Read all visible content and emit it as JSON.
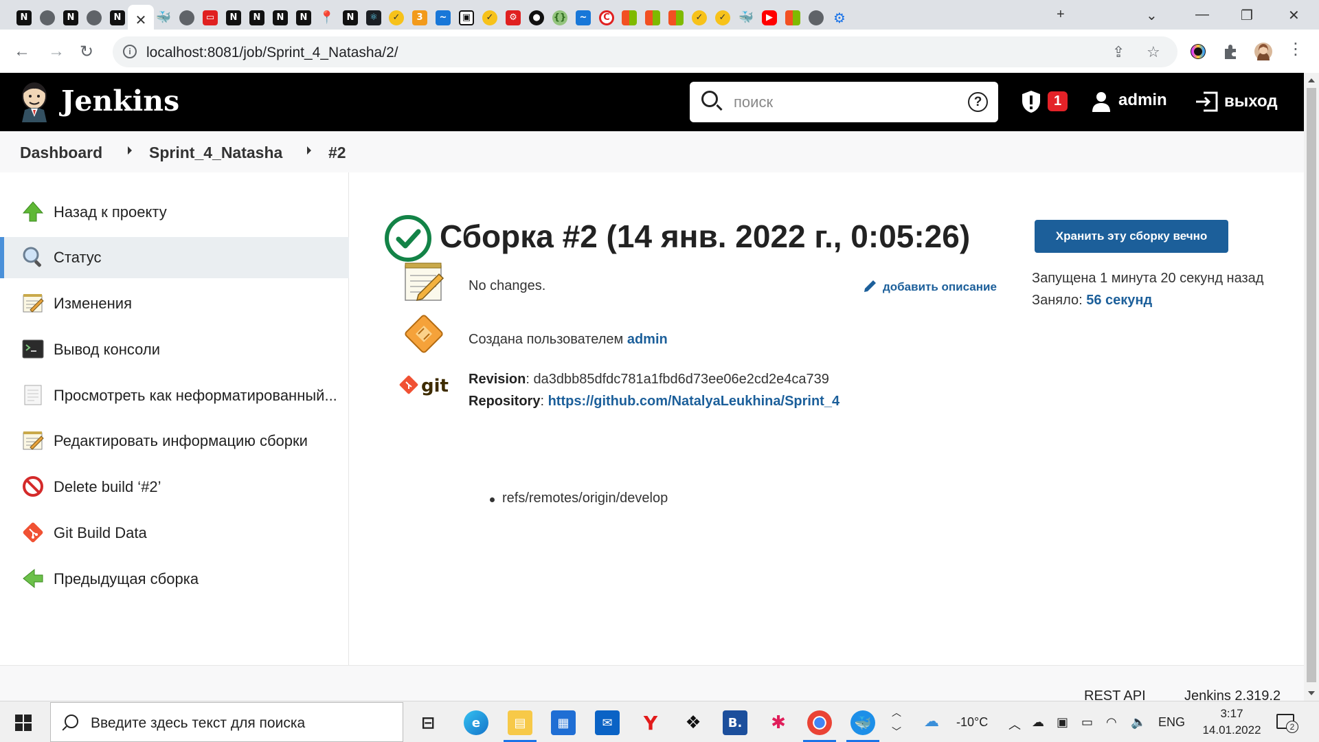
{
  "browser": {
    "url": "localhost:8081/job/Sprint_4_Natasha/2/",
    "tabs": [
      {
        "icon": "notion-icon",
        "glyph": "N"
      },
      {
        "icon": "globe-icon",
        "glyph": ""
      },
      {
        "icon": "notion-icon",
        "glyph": "N"
      },
      {
        "icon": "globe-icon",
        "glyph": ""
      },
      {
        "icon": "notion-icon",
        "glyph": "N"
      },
      {
        "icon": "close-icon",
        "glyph": "✕",
        "active": true
      },
      {
        "icon": "docker-icon",
        "glyph": "🐳"
      },
      {
        "icon": "globe-icon",
        "glyph": ""
      },
      {
        "icon": "red-app-icon",
        "glyph": "▭"
      },
      {
        "icon": "notion-icon",
        "glyph": "N"
      },
      {
        "icon": "notion-icon",
        "glyph": "N"
      },
      {
        "icon": "notion-icon",
        "glyph": "N"
      },
      {
        "icon": "notion-icon",
        "glyph": "N"
      },
      {
        "icon": "maps-pin-icon",
        "glyph": "📍"
      },
      {
        "icon": "notion-icon",
        "glyph": "N"
      },
      {
        "icon": "react-icon",
        "glyph": "⚛"
      },
      {
        "icon": "check-app-icon",
        "glyph": "✓"
      },
      {
        "icon": "orange-app-icon",
        "glyph": "3"
      },
      {
        "icon": "edge-dev-icon",
        "glyph": "~"
      },
      {
        "icon": "shield-app-icon",
        "glyph": "▣"
      },
      {
        "icon": "check-app-icon",
        "glyph": "✓"
      },
      {
        "icon": "mobx-icon",
        "glyph": "⚙"
      },
      {
        "icon": "github-icon",
        "glyph": "●"
      },
      {
        "icon": "json-icon",
        "glyph": "{}"
      },
      {
        "icon": "edge-dev-icon",
        "glyph": "~"
      },
      {
        "icon": "copyright-icon",
        "glyph": "C"
      },
      {
        "icon": "microsoft-icon",
        "glyph": ""
      },
      {
        "icon": "microsoft-icon",
        "glyph": ""
      },
      {
        "icon": "microsoft-icon",
        "glyph": ""
      },
      {
        "icon": "check-app-icon",
        "glyph": "✓"
      },
      {
        "icon": "check-app-icon",
        "glyph": "✓"
      },
      {
        "icon": "docker-icon",
        "glyph": "🐳"
      },
      {
        "icon": "youtube-icon",
        "glyph": "▶"
      },
      {
        "icon": "microsoft-icon",
        "glyph": ""
      },
      {
        "icon": "globe-icon",
        "glyph": ""
      },
      {
        "icon": "settings-icon",
        "glyph": "⚙"
      }
    ]
  },
  "header": {
    "title": "Jenkins",
    "search_placeholder": "поиск",
    "security_count": "1",
    "user": "admin",
    "logout": "выход"
  },
  "breadcrumb": [
    "Dashboard",
    "Sprint_4_Natasha",
    "#2"
  ],
  "sidebar": {
    "items": [
      {
        "label": "Назад к проекту",
        "icon": "up-arrow-icon"
      },
      {
        "label": "Статус",
        "icon": "magnifier-icon",
        "active": true
      },
      {
        "label": "Изменения",
        "icon": "notepad-icon"
      },
      {
        "label": "Вывод консоли",
        "icon": "terminal-icon"
      },
      {
        "label": "Просмотреть как неформатированный...",
        "icon": "document-icon"
      },
      {
        "label": "Редактировать информацию сборки",
        "icon": "notepad-icon"
      },
      {
        "label": "Delete build ‘#2’",
        "icon": "no-entry-icon"
      },
      {
        "label": "Git Build Data",
        "icon": "git-icon"
      },
      {
        "label": "Предыдущая сборка",
        "icon": "left-arrow-icon"
      }
    ]
  },
  "main": {
    "title": "Сборка #2 (14 янв. 2022 г., 0:05:26)",
    "keep_button": "Хранить эту сборку вечно",
    "started": "Запущена 1 минута 20 секунд назад",
    "duration_label": "Заняло: ",
    "duration_value": "56 секунд",
    "add_description": "добавить описание",
    "no_changes": "No changes.",
    "created_by_prefix": "Создана пользователем ",
    "created_by_user": "admin",
    "revision_label": "Revision",
    "revision_value": ": da3dbb85dfdc781a1fbd6d73ee06e2cd2e4ca739",
    "repository_label": "Repository",
    "repository_sep": ": ",
    "repository_url": "https://github.com/NatalyaLeukhina/Sprint_4",
    "branch": "refs/remotes/origin/develop"
  },
  "footer": {
    "rest_api": "REST API",
    "version": "Jenkins 2.319.2"
  },
  "taskbar": {
    "search_placeholder": "Введите здесь текст для поиска",
    "weather": "-10°C",
    "language": "ENG",
    "time": "3:17",
    "date": "14.01.2022",
    "notifications": "2"
  }
}
